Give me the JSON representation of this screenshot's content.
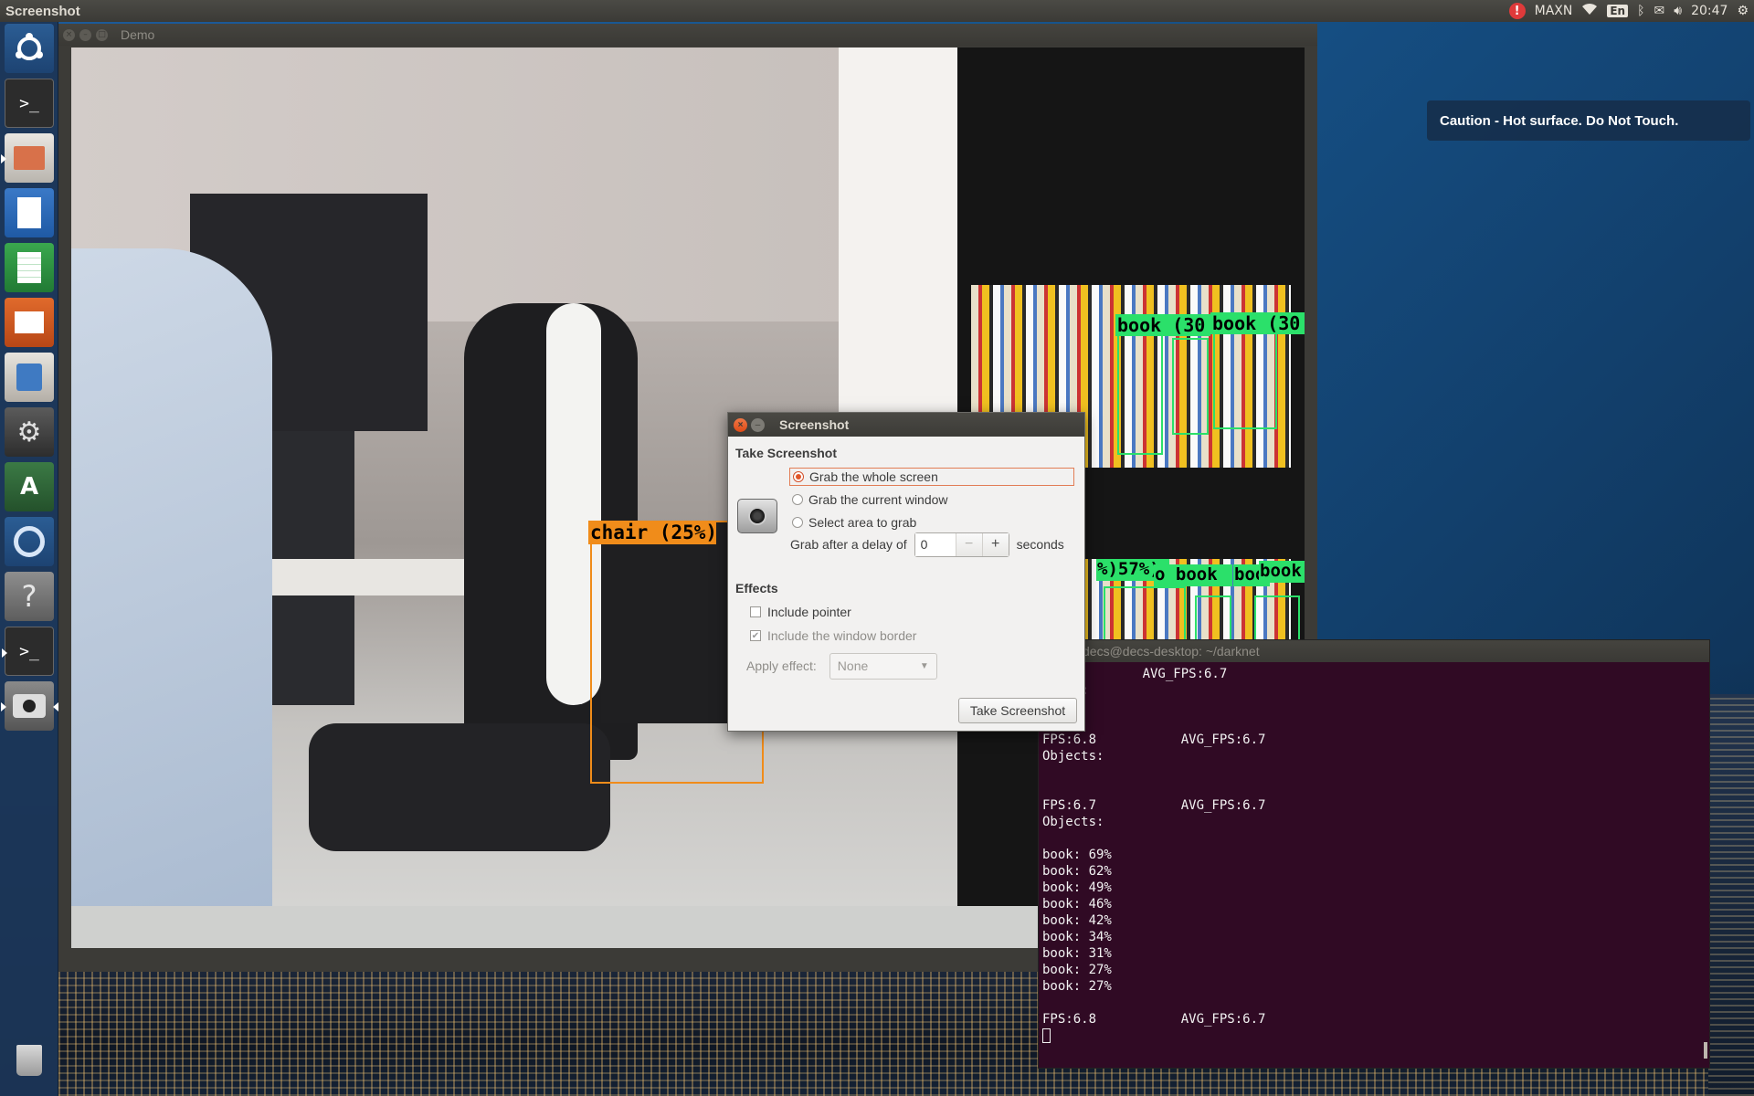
{
  "top_panel": {
    "title": "Screenshot",
    "tray": {
      "alert": "!",
      "power_mode": "MAXN",
      "language": "En",
      "clock": "20:47"
    }
  },
  "launcher": {
    "items": [
      "ubuntu-logo-icon",
      "terminal-icon",
      "files-icon",
      "writer-icon",
      "calc-icon",
      "impress-icon",
      "software-center-icon",
      "settings-icon",
      "software-updater-icon",
      "chromium-icon",
      "help-icon",
      "terminal-icon",
      "screenshot-icon",
      "trash-icon"
    ]
  },
  "demo_window": {
    "title": "Demo",
    "detections": [
      {
        "label": "chair (25%)",
        "color": "#f08c1a"
      },
      {
        "label": "book (30",
        "color": "#2be06a"
      },
      {
        "label": "book (30",
        "color": "#2be06a"
      },
      {
        "label": "%)57%)",
        "color": "#2be06a"
      },
      {
        "label": "o book",
        "color": "#2be06a"
      },
      {
        "label": "boo",
        "color": "#2be06a"
      },
      {
        "label": "book",
        "color": "#2be06a"
      }
    ]
  },
  "notification": {
    "text": "Caution - Hot surface. Do Not Touch."
  },
  "terminal": {
    "title": "decs@decs-desktop: ~/darknet",
    "lines": [
      ".7           AVG_FPS:6.7",
      "jects:",
      "",
      "",
      "FPS:6.8           AVG_FPS:6.7",
      "Objects:",
      "",
      "",
      "FPS:6.7           AVG_FPS:6.7",
      "Objects:",
      "",
      "book: 69%",
      "book: 62%",
      "book: 49%",
      "book: 46%",
      "book: 42%",
      "book: 34%",
      "book: 31%",
      "book: 27%",
      "book: 27%",
      "",
      "FPS:6.8           AVG_FPS:6.7"
    ]
  },
  "dialog": {
    "title": "Screenshot",
    "take_heading": "Take Screenshot",
    "options": {
      "whole_screen": "Grab the whole screen",
      "current_window": "Grab the current window",
      "select_area": "Select area to grab"
    },
    "selected_option": "whole_screen",
    "delay_label": "Grab after a delay of",
    "delay_value": "0",
    "delay_unit": "seconds",
    "effects_heading": "Effects",
    "include_pointer": "Include pointer",
    "include_pointer_checked": false,
    "include_border": "Include the window border",
    "include_border_checked": true,
    "apply_effect_label": "Apply effect:",
    "apply_effect_value": "None",
    "take_button": "Take Screenshot"
  },
  "colors": {
    "terminal_bg": "#300a24",
    "ubuntu_orange": "#e0562a",
    "detection_chair": "#f08c1a",
    "detection_book": "#2be06a",
    "notification_bg": "#162e4a"
  }
}
